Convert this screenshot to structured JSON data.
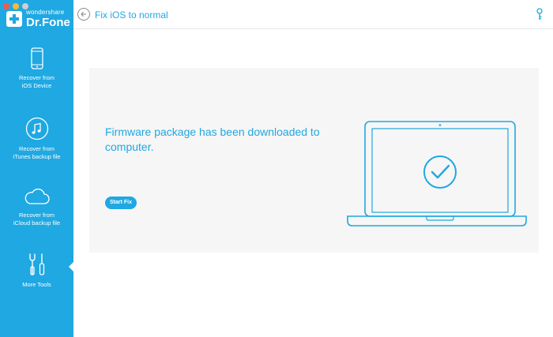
{
  "brand": {
    "small": "wondershare",
    "name": "Dr.Fone"
  },
  "sidebar": {
    "items": [
      {
        "line1": "Recover from",
        "line2": "iOS Device",
        "icon": "iphone-icon"
      },
      {
        "line1": "Recover from",
        "line2": "iTunes backup file",
        "icon": "music-note-icon"
      },
      {
        "line1": "Recover from",
        "line2": "iCloud backup file",
        "icon": "cloud-icon"
      },
      {
        "line1": "More Tools",
        "line2": "",
        "icon": "tools-icon"
      }
    ],
    "active_index": 3
  },
  "header": {
    "title": "Fix iOS to normal",
    "back_icon": "back-arrow-icon",
    "key_icon": "key-icon"
  },
  "main": {
    "message": "Firmware package has been downloaded to computer.",
    "start_button": "Start Fix",
    "illustration_icon": "laptop-check-icon"
  },
  "colors": {
    "accent": "#1fa8e2",
    "sidebar": "#1fa8e2",
    "panel": "#f6f6f6"
  }
}
